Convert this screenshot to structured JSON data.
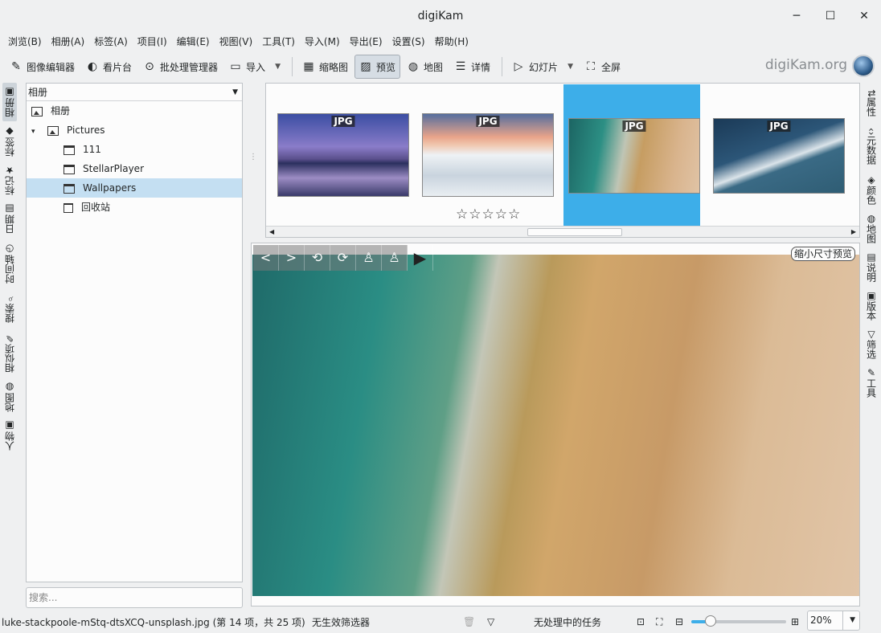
{
  "window": {
    "title": "digiKam",
    "minimize": "─",
    "maximize": "☐",
    "close": "✕"
  },
  "menu": [
    "浏览(B)",
    "相册(A)",
    "标签(A)",
    "项目(I)",
    "编辑(E)",
    "视图(V)",
    "工具(T)",
    "导入(M)",
    "导出(E)",
    "设置(S)",
    "帮助(H)"
  ],
  "toolbar": {
    "image_editor": "图像编辑器",
    "light_table": "看片台",
    "batch_queue": "批处理管理器",
    "import": "导入",
    "thumbnails": "缩略图",
    "preview": "预览",
    "map": "地图",
    "details": "详情",
    "slideshow": "幻灯片",
    "fullscreen": "全屏",
    "brand": "digiKam.org"
  },
  "left_tabs": [
    "相册",
    "标签",
    "标记",
    "日期",
    "时间轴",
    "搜索",
    "相似项",
    "地图",
    "人物"
  ],
  "right_tabs": [
    "属性",
    "元数据",
    "颜色",
    "地图",
    "说明",
    "版本",
    "筛选",
    "工具"
  ],
  "album_panel": {
    "selector": "相册",
    "tree": [
      {
        "label": "相册",
        "icon": "image-album-icon"
      },
      {
        "label": "Pictures",
        "icon": "image-album-icon"
      },
      {
        "label": "111",
        "icon": "folder-icon"
      },
      {
        "label": "StellarPlayer",
        "icon": "folder-icon"
      },
      {
        "label": "Wallpapers",
        "icon": "folder-icon"
      },
      {
        "label": "回收站",
        "icon": "trash-icon"
      }
    ],
    "expand_arrow": "▾",
    "search_placeholder": "搜索..."
  },
  "thumbnails": [
    {
      "badge": "JPG",
      "selected": false
    },
    {
      "badge": "JPG",
      "selected": false
    },
    {
      "badge": "JPG",
      "selected": true
    },
    {
      "badge": "JPG",
      "selected": false
    }
  ],
  "rating_stars": "☆☆☆☆☆",
  "preview": {
    "zoom_label": "缩小尺寸预览",
    "buttons": [
      "<",
      ">",
      "⟲",
      "⟳",
      "♙",
      "♙",
      "▶"
    ]
  },
  "status": {
    "file": "luke-stackpoole-mStq-dtsXCQ-unsplash.jpg (第 14 项，共 25 项)",
    "filter": "无生效筛选器",
    "tasks": "无处理中的任务",
    "zoom": "20%",
    "zoom_fraction": 0.2
  },
  "colors": {
    "accent": "#3daee9",
    "selection": "#c4dff2"
  }
}
